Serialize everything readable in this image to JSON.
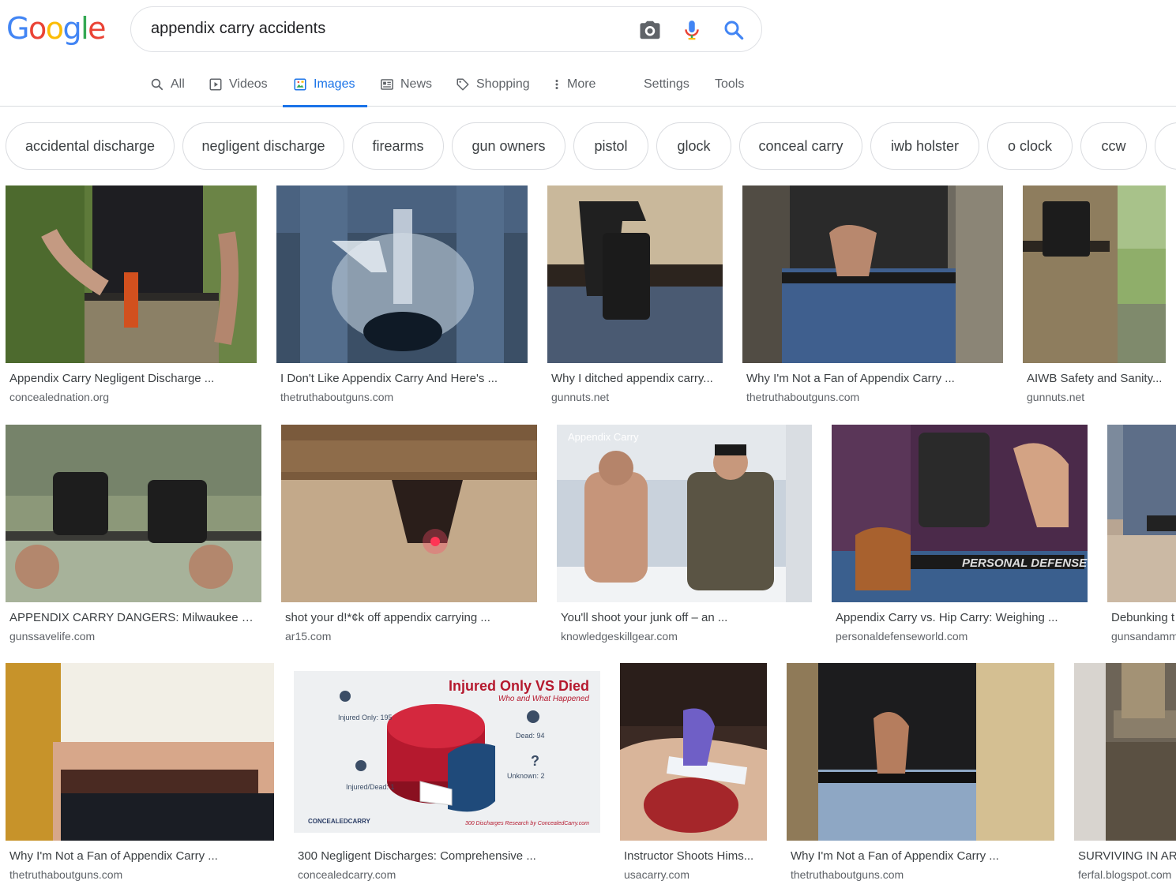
{
  "logo": {
    "text": "Google",
    "letters": [
      {
        "ch": "G",
        "color": "#4285f4"
      },
      {
        "ch": "o",
        "color": "#ea4335"
      },
      {
        "ch": "o",
        "color": "#fbbc05"
      },
      {
        "ch": "g",
        "color": "#4285f4"
      },
      {
        "ch": "l",
        "color": "#34a853"
      },
      {
        "ch": "e",
        "color": "#ea4335"
      }
    ]
  },
  "search": {
    "query": "appendix carry accidents",
    "icons": [
      "camera-icon",
      "microphone-icon",
      "search-icon"
    ]
  },
  "tabs": [
    {
      "label": "All",
      "icon": "search-icon"
    },
    {
      "label": "Videos",
      "icon": "play-icon"
    },
    {
      "label": "Images",
      "icon": "image-icon",
      "active": true
    },
    {
      "label": "News",
      "icon": "news-icon"
    },
    {
      "label": "Shopping",
      "icon": "tag-icon"
    },
    {
      "label": "More",
      "icon": "more-icon"
    },
    {
      "label": "Settings"
    },
    {
      "label": "Tools"
    }
  ],
  "chips": [
    "accidental discharge",
    "negligent discharge",
    "firearms",
    "gun owners",
    "pistol",
    "glock",
    "conceal carry",
    "iwb holster",
    "o clock",
    "ccw"
  ],
  "results": [
    {
      "title": "Appendix Carry Negligent Discharge ...",
      "source": "concealednation.org"
    },
    {
      "title": "I Don't Like Appendix Carry And Here's ...",
      "source": "thetruthaboutguns.com"
    },
    {
      "title": "Why I ditched appendix carry...",
      "source": "gunnuts.net"
    },
    {
      "title": "Why I'm Not a Fan of Appendix Carry ...",
      "source": "thetruthaboutguns.com"
    },
    {
      "title": "AIWB Safety and Sanity...",
      "source": "gunnuts.net"
    },
    {
      "title": "APPENDIX CARRY DANGERS: Milwaukee m...",
      "source": "gunssavelife.com"
    },
    {
      "title": "shot your d!*¢k off appendix carrying ...",
      "source": "ar15.com"
    },
    {
      "title": "You'll shoot your junk off – an ...",
      "source": "knowledgeskillgear.com",
      "overlay": "Appendix Carry"
    },
    {
      "title": "Appendix Carry vs. Hip Carry: Weighing ...",
      "source": "personaldefenseworld.com",
      "overlay": "PERSONAL DEFENSE WORLD.COM"
    },
    {
      "title": "Debunking t",
      "source": "gunsandamm"
    },
    {
      "title": "Why I'm Not a Fan of Appendix Carry ...",
      "source": "thetruthaboutguns.com"
    },
    {
      "title": "300 Negligent Discharges: Comprehensive ...",
      "source": "concealedcarry.com",
      "infographic": {
        "heading": "Injured Only VS Died",
        "subheading": "Who and What Happened",
        "injured_only": "Injured Only: 195",
        "dead": "Dead: 94",
        "injured_dead": "Injured/Dead: 1",
        "unknown": "Unknown: 2",
        "brand": "CONCEALEDCARRY",
        "footer": "300 Discharges Research by ConcealedCarry.com"
      }
    },
    {
      "title": "Instructor Shoots Hims...",
      "source": "usacarry.com"
    },
    {
      "title": "Why I'm Not a Fan of Appendix Carry ...",
      "source": "thetruthaboutguns.com"
    },
    {
      "title": "SURVIVING IN ARC",
      "source": "ferfal.blogspot.com"
    }
  ],
  "colors": {
    "accent": "#1a73e8",
    "text": "#202124",
    "secondary": "#5f6368",
    "border": "#dadce0"
  }
}
